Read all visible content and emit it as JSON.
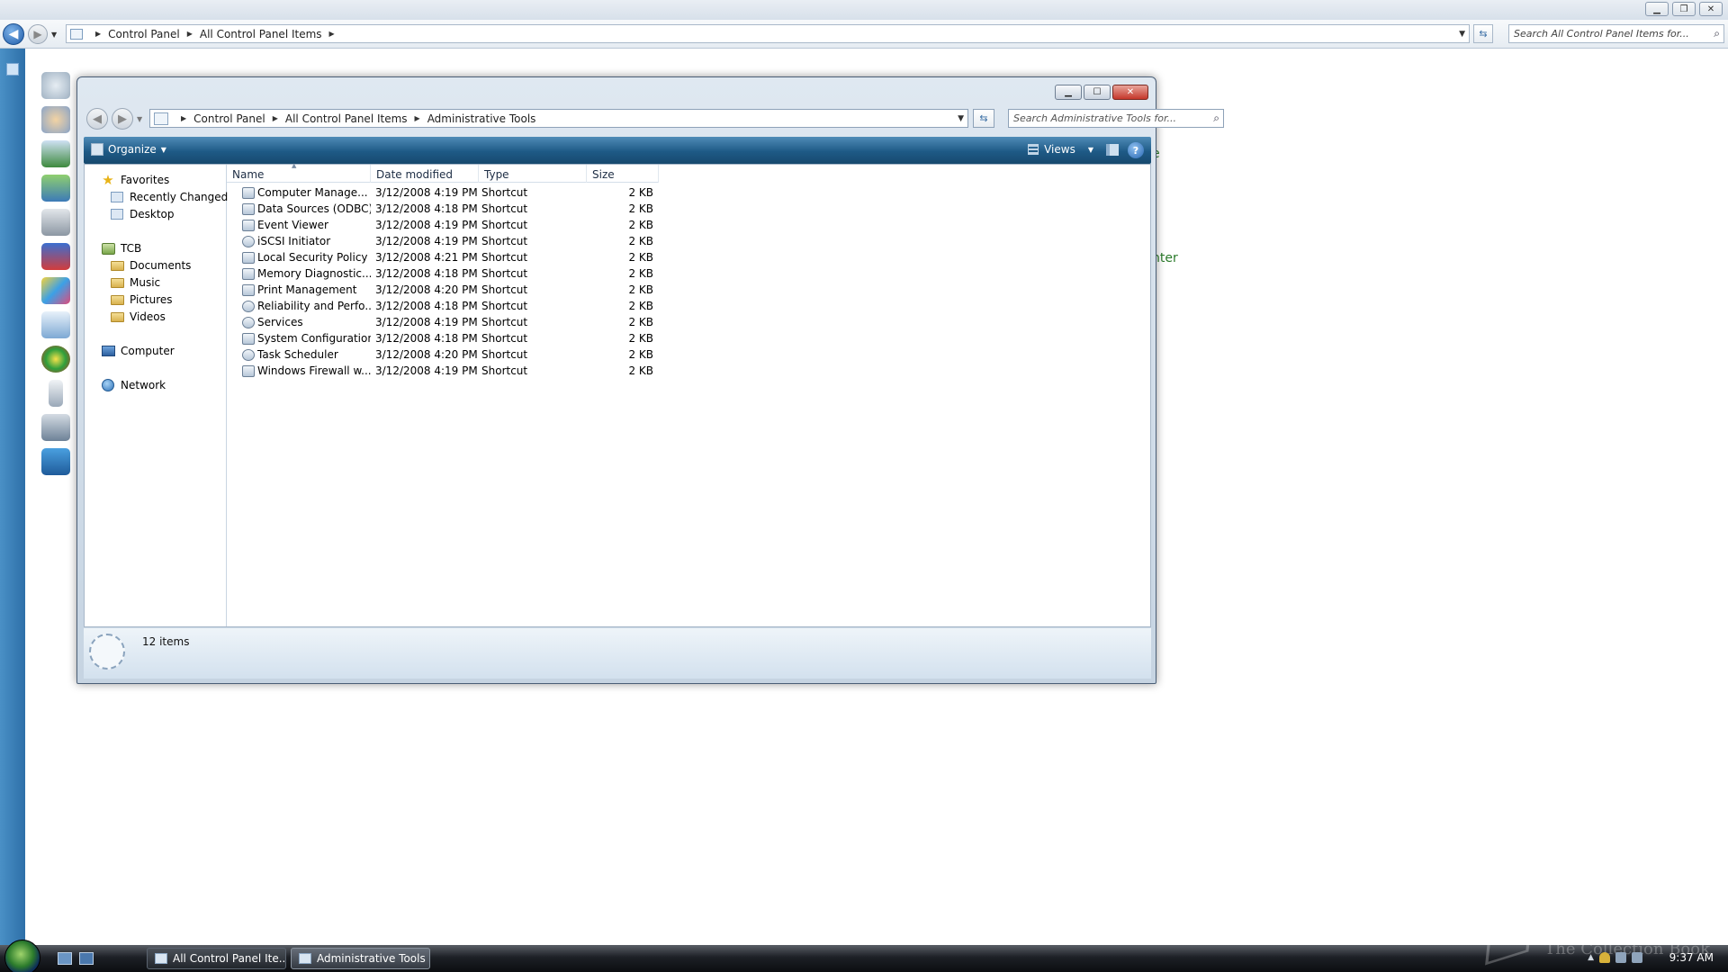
{
  "background_window": {
    "breadcrumb": [
      "Control Panel",
      "All Control Panel Items"
    ],
    "search_placeholder": "Search All Control Panel Items for...",
    "fragments": [
      "e",
      "nter"
    ]
  },
  "window": {
    "breadcrumb": [
      "Control Panel",
      "All Control Panel Items",
      "Administrative Tools"
    ],
    "search_placeholder": "Search Administrative Tools for...",
    "toolbar": {
      "organize": "Organize",
      "views": "Views",
      "help": "?"
    }
  },
  "nav": {
    "favorites": "Favorites",
    "favorite_items": [
      "Recently Changed",
      "Desktop"
    ],
    "user": "TCB",
    "user_items": [
      "Documents",
      "Music",
      "Pictures",
      "Videos"
    ],
    "computer": "Computer",
    "network": "Network"
  },
  "columns": {
    "name": "Name",
    "date": "Date modified",
    "type": "Type",
    "size": "Size"
  },
  "files": [
    {
      "name": "Computer Manage...",
      "date": "3/12/2008 4:19 PM",
      "type": "Shortcut",
      "size": "2 KB"
    },
    {
      "name": "Data Sources (ODBC)",
      "date": "3/12/2008 4:18 PM",
      "type": "Shortcut",
      "size": "2 KB"
    },
    {
      "name": "Event Viewer",
      "date": "3/12/2008 4:19 PM",
      "type": "Shortcut",
      "size": "2 KB"
    },
    {
      "name": "iSCSI Initiator",
      "date": "3/12/2008 4:19 PM",
      "type": "Shortcut",
      "size": "2 KB"
    },
    {
      "name": "Local Security Policy",
      "date": "3/12/2008 4:21 PM",
      "type": "Shortcut",
      "size": "2 KB"
    },
    {
      "name": "Memory Diagnostic...",
      "date": "3/12/2008 4:18 PM",
      "type": "Shortcut",
      "size": "2 KB"
    },
    {
      "name": "Print Management",
      "date": "3/12/2008 4:20 PM",
      "type": "Shortcut",
      "size": "2 KB"
    },
    {
      "name": "Reliability and Perfo...",
      "date": "3/12/2008 4:18 PM",
      "type": "Shortcut",
      "size": "2 KB"
    },
    {
      "name": "Services",
      "date": "3/12/2008 4:19 PM",
      "type": "Shortcut",
      "size": "2 KB"
    },
    {
      "name": "System Configuration",
      "date": "3/12/2008 4:18 PM",
      "type": "Shortcut",
      "size": "2 KB"
    },
    {
      "name": "Task Scheduler",
      "date": "3/12/2008 4:20 PM",
      "type": "Shortcut",
      "size": "2 KB"
    },
    {
      "name": "Windows Firewall w...",
      "date": "3/12/2008 4:19 PM",
      "type": "Shortcut",
      "size": "2 KB"
    }
  ],
  "status": {
    "count": "12 items"
  },
  "taskbar": {
    "tasks": [
      "All Control Panel Ite...",
      "Administrative Tools"
    ],
    "clock": "9:37 AM",
    "watermark": "The Collection Book"
  }
}
